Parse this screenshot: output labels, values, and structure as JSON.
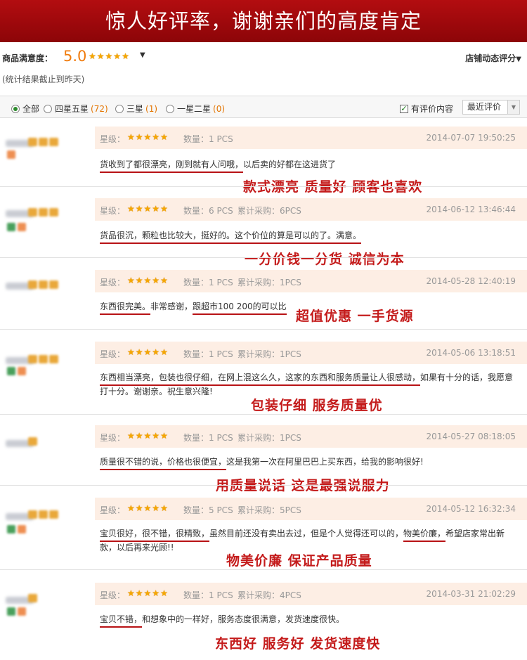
{
  "banner": {
    "title": "惊人好评率，谢谢亲们的高度肯定"
  },
  "summary": {
    "label": "商品满意度：",
    "score": "5.0",
    "shop_rating_label": "店铺动态评分",
    "note": "(统计结果截止到昨天)"
  },
  "filter": {
    "all_label": "全部",
    "four_five_label": "四星五星",
    "four_five_count": "(72)",
    "three_label": "三星",
    "three_count": "(1)",
    "one_two_label": "一星二星",
    "one_two_count": "(0)",
    "has_content_label": "有评价内容",
    "sort_value": "最近评价"
  },
  "colors": {
    "banner": "#a00a0d",
    "accent": "#f07b0c",
    "highlight": "#c41b1b",
    "meta_bg": "#fdeee4"
  },
  "icons": {
    "star": "star-icon",
    "checkbox": "checkbox-icon",
    "dropdown": "chevron-down-icon"
  },
  "labels": {
    "star": "星级："
  },
  "reviews": [
    {
      "qty": "数量：1 PCS",
      "cum": "",
      "date": "2014-07-07 19:50:25",
      "text_a": "货收到了都很漂亮，刚到就有人问哦，",
      "text_b": "以后卖的好都在这进货了",
      "highlight": "款式漂亮    质量好    顾客也喜欢"
    },
    {
      "qty": "数量：6 PCS",
      "cum": "累计采购：6PCS",
      "date": "2014-06-12 13:46:44",
      "text_a": "货品很沉，颗粒也比较大，挺好的。这个价位的算是可以的了。满意。",
      "text_b": "",
      "highlight": "一分价钱一分货    诚信为本"
    },
    {
      "qty": "数量：1 PCS",
      "cum": "累计采购：1PCS",
      "date": "2014-05-28 12:40:19",
      "text_a": "东西很完美。",
      "text_m": "非常感谢，",
      "text_b": "跟超市100 200的可以比",
      "highlight": "超值优惠    一手货源"
    },
    {
      "qty": "数量：1 PCS",
      "cum": "累计采购：1PCS",
      "date": "2014-05-06 13:18:51",
      "text_a": "东西相当漂亮，包装也很仔细，在网上混这么久，这家的东西和服务质量让人很感动，",
      "text_b": "如果有十分的话，我愿意打十分。谢谢亲。祝生意兴隆!",
      "highlight": "包装仔细    服务质量优"
    },
    {
      "qty": "数量：1 PCS",
      "cum": "累计采购：1PCS",
      "date": "2014-05-27 08:18:05",
      "text_a": "质量很不错的说，价格也很便宜，",
      "text_b": "这是我第一次在阿里巴巴上买东西，给我的影响很好!",
      "highlight": "用质量说话    这是最强说服力"
    },
    {
      "qty": "数量：5 PCS",
      "cum": "累计采购：5PCS",
      "date": "2014-05-12 16:32:34",
      "text_a": "宝贝很好，很不错，很精致，",
      "text_b": "虽然目前还没有卖出去过，但是个人觉得还可以的，",
      "text_c": "物美价廉，",
      "text_d": "希望店家常出新款，以后再来光顾!!",
      "highlight": "物美价廉    保证产品质量"
    },
    {
      "qty": "数量：1 PCS",
      "cum": "累计采购：4PCS",
      "date": "2014-03-31 21:02:29",
      "text_a": "宝贝不错，",
      "text_b": "和想象中的一样好，服务态度很满意，发货速度很快。",
      "highlight": "东西好    服务好    发货速度快"
    }
  ]
}
